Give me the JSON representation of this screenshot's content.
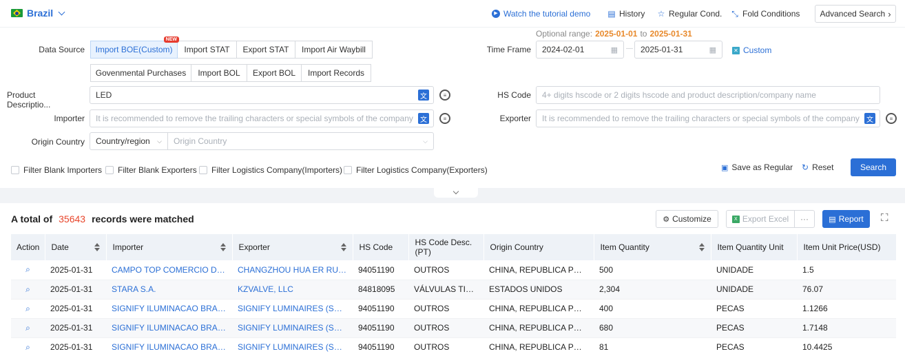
{
  "header": {
    "country": "Brazil",
    "tutorial": "Watch the tutorial demo",
    "history": "History",
    "regular": "Regular Cond.",
    "fold": "Fold Conditions",
    "advanced": "Advanced Search"
  },
  "form": {
    "data_source_label": "Data Source",
    "tabs_row1": [
      "Import BOE(Custom)",
      "Import STAT",
      "Export STAT",
      "Import Air Waybill"
    ],
    "tabs_row2": [
      "Govenmental Purchases",
      "Import BOL",
      "Export BOL",
      "Import Records"
    ],
    "new_badge": "NEW",
    "optional_range_label": "Optional range:",
    "optional_from": "2025-01-01",
    "optional_to_word": "to",
    "optional_to": "2025-01-31",
    "time_frame_label": "Time Frame",
    "date_from": "2024-02-01",
    "date_to": "2025-01-31",
    "date_sep": "—",
    "custom": "Custom",
    "product_label": "Product Descriptio...",
    "product_value": "LED",
    "hs_label": "HS Code",
    "hs_placeholder": "4+ digits hscode or 2 digits hscode and product description/company name",
    "importer_label": "Importer",
    "importer_placeholder": "It is recommended to remove the trailing characters or special symbols of the company",
    "exporter_label": "Exporter",
    "exporter_placeholder": "It is recommended to remove the trailing characters or special symbols of the company",
    "origin_label": "Origin Country",
    "origin_select": "Country/region",
    "origin_placeholder": "Origin Country",
    "filters": [
      "Filter Blank Importers",
      "Filter Blank Exporters",
      "Filter Logistics Company(Importers)",
      "Filter Logistics Company(Exporters)"
    ],
    "save_regular": "Save as Regular",
    "reset": "Reset",
    "search": "Search"
  },
  "results": {
    "prefix": "A total of",
    "count": "35643",
    "suffix": "records were matched",
    "customize": "Customize",
    "export_excel": "Export Excel",
    "more": "···",
    "report": "Report"
  },
  "table": {
    "columns": [
      "Action",
      "Date",
      "Importer",
      "Exporter",
      "HS Code",
      "HS Code Desc.\n(PT)",
      "Origin Country",
      "Item Quantity",
      "Item Quantity Unit",
      "Item Unit Price(USD)"
    ],
    "rows": [
      [
        "2025-01-31",
        "CAMPO TOP COMERCIO DE ELETRONICOS",
        "CHANGZHOU HUA ER RUI INTERNATIONAL",
        "94051190",
        "OUTROS",
        "CHINA, REPUBLICA POPULA",
        "500",
        "UNIDADE",
        "1.5"
      ],
      [
        "2025-01-31",
        "STARA S.A.",
        "KZVALVE, LLC",
        "84818095",
        "VÁLVULAS TIPO GLOBO",
        "ESTADOS UNIDOS",
        "2,304",
        "UNIDADE",
        "76.07"
      ],
      [
        "2025-01-31",
        "SIGNIFY ILUMINACAO BRASIL LTDA",
        "SIGNIFY LUMINAIRES (SHANGHAI)",
        "94051190",
        "OUTROS",
        "CHINA, REPUBLICA POPULA",
        "400",
        "PECAS",
        "1.1266"
      ],
      [
        "2025-01-31",
        "SIGNIFY ILUMINACAO BRASIL LTDA",
        "SIGNIFY LUMINAIRES (SHANGHAI)",
        "94051190",
        "OUTROS",
        "CHINA, REPUBLICA POPULA",
        "680",
        "PECAS",
        "1.7148"
      ],
      [
        "2025-01-31",
        "SIGNIFY ILUMINACAO BRASIL LTDA",
        "SIGNIFY LUMINAIRES (SHANGHAI)",
        "94051190",
        "OUTROS",
        "CHINA, REPUBLICA POPULA",
        "81",
        "PECAS",
        "10.4425"
      ]
    ]
  }
}
